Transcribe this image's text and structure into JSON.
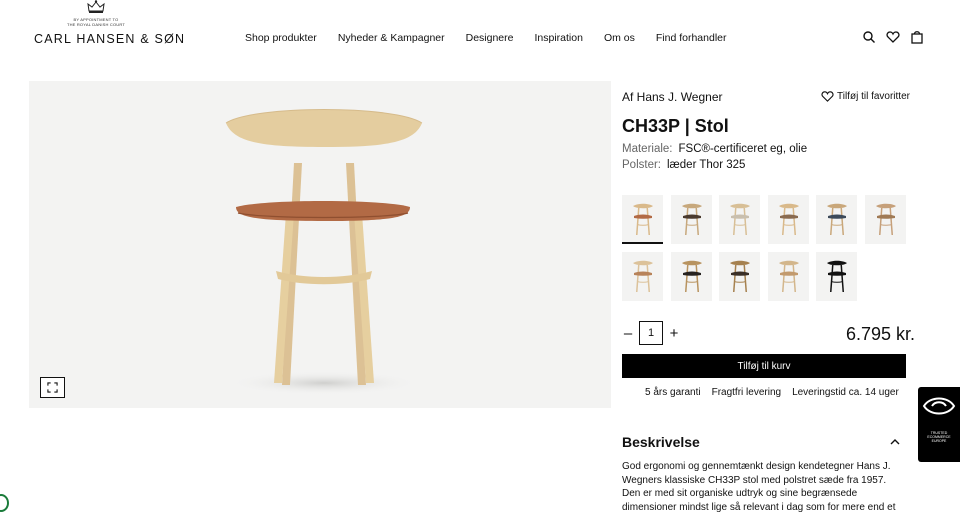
{
  "header": {
    "logo": {
      "appointment_line1": "BY APPOINTMENT TO",
      "appointment_line2": "THE ROYAL DANISH COURT",
      "name": "CARL HANSEN & SØN"
    },
    "nav": [
      "Shop produkter",
      "Nyheder & Kampagner",
      "Designere",
      "Inspiration",
      "Om os",
      "Find forhandler"
    ],
    "icons": [
      "search-icon",
      "heart-icon",
      "bag-icon"
    ]
  },
  "product": {
    "designer": "Af Hans J. Wegner",
    "favorite_label": "Tilføj til favoritter",
    "title": "CH33P | Stol",
    "specs": [
      {
        "key": "Materiale:",
        "value": "FSC®-certificeret eg, olie"
      },
      {
        "key": "Polster:",
        "value": "læder Thor 325"
      }
    ],
    "variants": [
      {
        "wood": "#d9b98a",
        "seat": "#b26a45",
        "selected": true
      },
      {
        "wood": "#c7a87c",
        "seat": "#4a3a2e"
      },
      {
        "wood": "#d8bf96",
        "seat": "#c9bfae"
      },
      {
        "wood": "#d9b98a",
        "seat": "#8a6b50"
      },
      {
        "wood": "#c9a77a",
        "seat": "#3d4a5a"
      },
      {
        "wood": "#c6a07a",
        "seat": "#a07a55"
      },
      {
        "wood": "#dcc29a",
        "seat": "#b8835a"
      },
      {
        "wood": "#b8935f",
        "seat": "#26221f"
      },
      {
        "wood": "#a6814f",
        "seat": "#3a2f27"
      },
      {
        "wood": "#d3b68b",
        "seat": "#c29a6d"
      },
      {
        "wood": "#111111",
        "seat": "#111111"
      }
    ],
    "quantity": "1",
    "qty_minus": "–",
    "qty_plus": "+",
    "price": "6.795 kr.",
    "cart_label": "Tilføj til kurv",
    "usps": [
      "5 års garanti",
      "Fragtfri levering",
      "Leveringstid ca. 14 uger"
    ],
    "description_heading": "Beskrivelse",
    "description_text": "God ergonomi og gennemtænkt design kendetegner Hans J. Wegners klassiske CH33P stol med polstret sæde fra 1957. Den er med sit organiske udtryk og sine begrænsede dimensioner mindst lige så relevant i dag som for mere end et halvt århundrede siden."
  },
  "trust_badge": {
    "label": "TRUSTED ECOMMERCE EUROPE"
  },
  "colors": {
    "accent": "#000000",
    "panel": "#f3f3f2",
    "leather": "#b26a45",
    "oak": "#e3cb9e"
  }
}
